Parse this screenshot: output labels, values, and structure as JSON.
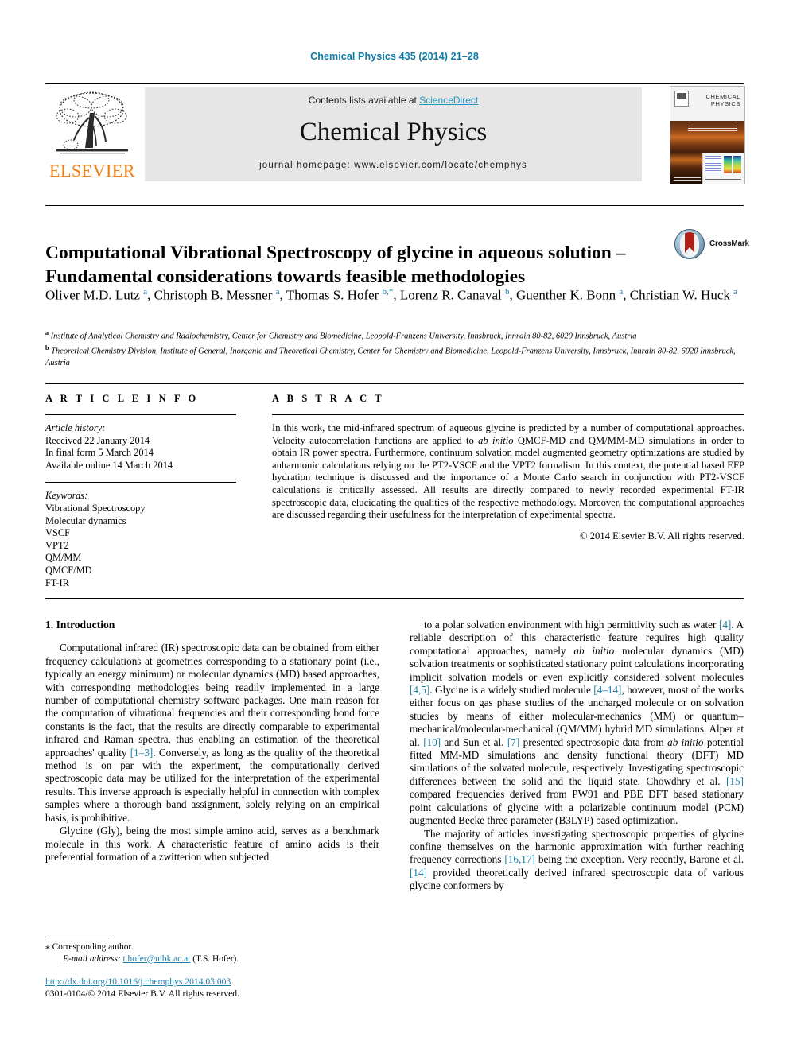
{
  "running_head": "Chemical Physics 435 (2014) 21–28",
  "masthead": {
    "publisher_name": "ELSEVIER",
    "contents_prefix": "Contents lists available at ",
    "contents_link": "ScienceDirect",
    "journal_title": "Chemical Physics",
    "homepage": "journal homepage: www.elsevier.com/locate/chemphys",
    "cover_title_line1": "CHEMICAL",
    "cover_title_line2": "PHYSICS"
  },
  "article": {
    "title": "Computational Vibrational Spectroscopy of glycine in aqueous solution – Fundamental considerations towards feasible methodologies",
    "crossmark_label": "CrossMark",
    "authors_html": "Oliver M.D. Lutz <sup>a</sup>, Christoph B. Messner <sup>a</sup>, Thomas S. Hofer <sup>b,</sup><sup class=\"ast\">*</sup>, Lorenz R. Canaval <sup>b</sup>, Guenther K. Bonn <sup>a</sup>, Christian W. Huck <sup>a</sup>",
    "affiliation_a": "Institute of Analytical Chemistry and Radiochemistry, Center for Chemistry and Biomedicine, Leopold-Franzens University, Innsbruck, Innrain 80-82, 6020 Innsbruck, Austria",
    "affiliation_b": "Theoretical Chemistry Division, Institute of General, Inorganic and Theoretical Chemistry, Center for Chemistry and Biomedicine, Leopold-Franzens University, Innsbruck, Innrain 80-82, 6020 Innsbruck, Austria"
  },
  "article_info": {
    "heading": "A R T I C L E    I N F O",
    "history_label": "Article history:",
    "history": [
      "Received 22 January 2014",
      "In final form 5 March 2014",
      "Available online 14 March 2014"
    ],
    "keywords_label": "Keywords:",
    "keywords": [
      "Vibrational Spectroscopy",
      "Molecular dynamics",
      "VSCF",
      "VPT2",
      "QM/MM",
      "QMCF/MD",
      "FT-IR"
    ]
  },
  "abstract": {
    "heading": "A B S T R A C T",
    "body_html": "In this work, the mid-infrared spectrum of aqueous glycine is predicted by a number of computational approaches. Velocity autocorrelation functions are applied to <span class=\"ital\">ab initio</span> QMCF-MD and QM/MM-MD simulations in order to obtain IR power spectra. Furthermore, continuum solvation model augmented geometry optimizations are studied by anharmonic calculations relying on the PT2-VSCF and the VPT2 formalism. In this context, the potential based EFP hydration technique is discussed and the importance of a Monte Carlo search in conjunction with PT2-VSCF calculations is critically assessed. All results are directly compared to newly recorded experimental FT-IR spectroscopic data, elucidating the qualities of the respective methodology. Moreover, the computational approaches are discussed regarding their usefulness for the interpretation of experimental spectra.",
    "copyright": "© 2014 Elsevier B.V. All rights reserved."
  },
  "body": {
    "section_heading": "1. Introduction",
    "left_paragraphs_html": [
      "Computational infrared (IR) spectroscopic data can be obtained from either frequency calculations at geometries corresponding to a stationary point (i.e., typically an energy minimum) or molecular dynamics (MD) based approaches, with corresponding methodologies being readily implemented in a large number of computational chemistry software packages. One main reason for the computation of vibrational frequencies and their corresponding bond force constants is the fact, that the results are directly comparable to experimental infrared and Raman spectra, thus enabling an estimation of the theoretical approaches' quality <span class=\"ref\">[1–3]</span>. Conversely, as long as the quality of the theoretical method is on par with the experiment, the computationally derived spectroscopic data may be utilized for the interpretation of the experimental results. This inverse approach is especially helpful in connection with complex samples where a thorough band assignment, solely relying on an empirical basis, is prohibitive.",
      "Glycine (Gly), being the most simple amino acid, serves as a benchmark molecule in this work. A characteristic feature of amino acids is their preferential formation of a zwitterion when subjected"
    ],
    "right_paragraphs_html": [
      "to a polar solvation environment with high permittivity such as water <span class=\"ref\">[4]</span>. A reliable description of this characteristic feature requires high quality computational approaches, namely <span class=\"ital\">ab initio</span> molecular dynamics (MD) solvation treatments or sophisticated stationary point calculations incorporating implicit solvation models or even explicitly considered solvent molecules <span class=\"ref\">[4,5]</span>. Glycine is a widely studied molecule <span class=\"ref\">[4–14]</span>, however, most of the works either focus on gas phase studies of the uncharged molecule or on solvation studies by means of either molecular-mechanics (MM) or quantum–mechanical/molecular-mechanical (QM/MM) hybrid MD simulations. Alper et al. <span class=\"ref\">[10]</span> and Sun et al. <span class=\"ref\">[7]</span> presented spectrosopic data from <span class=\"ital\">ab initio</span> potential fitted MM-MD simulations and density functional theory (DFT) MD simulations of the solvated molecule, respectively. Investigating spectroscopic differences between the solid and the liquid state, Chowdhry et al. <span class=\"ref\">[15]</span> compared frequencies derived from PW91 and PBE DFT based stationary point calculations of glycine with a polarizable continuum model (PCM) augmented Becke three parameter (B3LYP) based optimization.",
      "The majority of articles investigating spectroscopic properties of glycine confine themselves on the harmonic approximation with further reaching frequency corrections <span class=\"ref\">[16,17]</span> being the exception. Very recently, Barone et al. <span class=\"ref\">[14]</span> provided theoretically derived infrared spectroscopic data of various glycine conformers by"
    ]
  },
  "footnotes": {
    "corresponding_marker": "⁎",
    "corresponding_text": "Corresponding author.",
    "email_label": "E-mail address:",
    "email": "t.hofer@uibk.ac.at",
    "email_suffix": "(T.S. Hofer).",
    "doi": "http://dx.doi.org/10.1016/j.chemphys.2014.03.003",
    "issn_line": "0301-0104/© 2014 Elsevier B.V. All rights reserved."
  },
  "colors": {
    "link": "#1b7fa8",
    "sciencedirect": "#2196c4",
    "elsevier_orange": "#ee7d11",
    "crossmark_red": "#b01f16"
  }
}
